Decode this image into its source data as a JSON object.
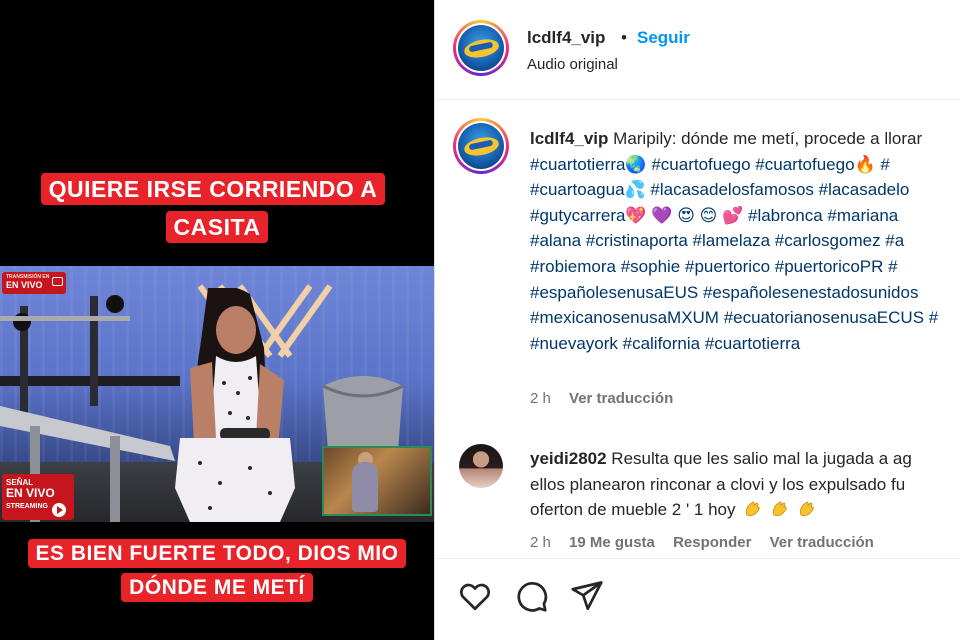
{
  "video": {
    "caption_top": "QUIERE IRSE CORRIENDO A CASITA",
    "caption_bottom": "ES BIEN FUERTE TODO, DIOS MIO DÓNDE ME METÍ",
    "badge_top_small": "TRANSMISIÓN EN",
    "badge_top_main": "EN VIVO",
    "badge_bottom_l1": "SEÑAL",
    "badge_bottom_l2": "EN VIVO",
    "badge_bottom_l3": "STREAMING"
  },
  "header": {
    "username": "lcdlf4_vip",
    "separator": "•",
    "follow_label": "Seguir",
    "audio_label": "Audio original"
  },
  "caption": {
    "username": "lcdlf4_vip",
    "text": "Maripily: dónde me metí, procede a llorar",
    "hashtag_lines": [
      "#cuartotierra🌏 #cuartofuego #cuartofuego🔥 #",
      "#cuartoagua💦 #lacasadelosfamosos #lacasadelo",
      "#gutycarrera💖 💜 😍 😊 💕 #labronca #mariana",
      "#alana #cristinaporta #lamelaza #carlosgomez #a",
      "#robiemora #sophie #puertorico #puertoricoPR #",
      "#españolesenusaEUS #españolesenestadosunidos",
      "#mexicanosenusaMXUM #ecuatorianosenusaECUS #",
      "#nuevayork #california #cuartotierra"
    ],
    "time": "2 h",
    "translate_label": "Ver traducción"
  },
  "comment": {
    "username": "yeidi2802",
    "lines": [
      "Resulta que les salio mal la jugada a ag",
      "ellos planearon rinconar a clovi y los expulsado fu",
      "oferton de mueble 2 ' 1 hoy"
    ],
    "time": "2 h",
    "likes": "19 Me gusta",
    "reply_label": "Responder",
    "translate_label": "Ver traducción"
  },
  "actions": {
    "like_icon": "heart-outline-icon",
    "comment_icon": "comment-bubble-icon",
    "share_icon": "paper-plane-icon"
  },
  "colors": {
    "follow_blue": "#0095f6",
    "hashtag_blue": "#00376b",
    "caption_red": "#e8232a",
    "meta_gray": "#737373"
  }
}
